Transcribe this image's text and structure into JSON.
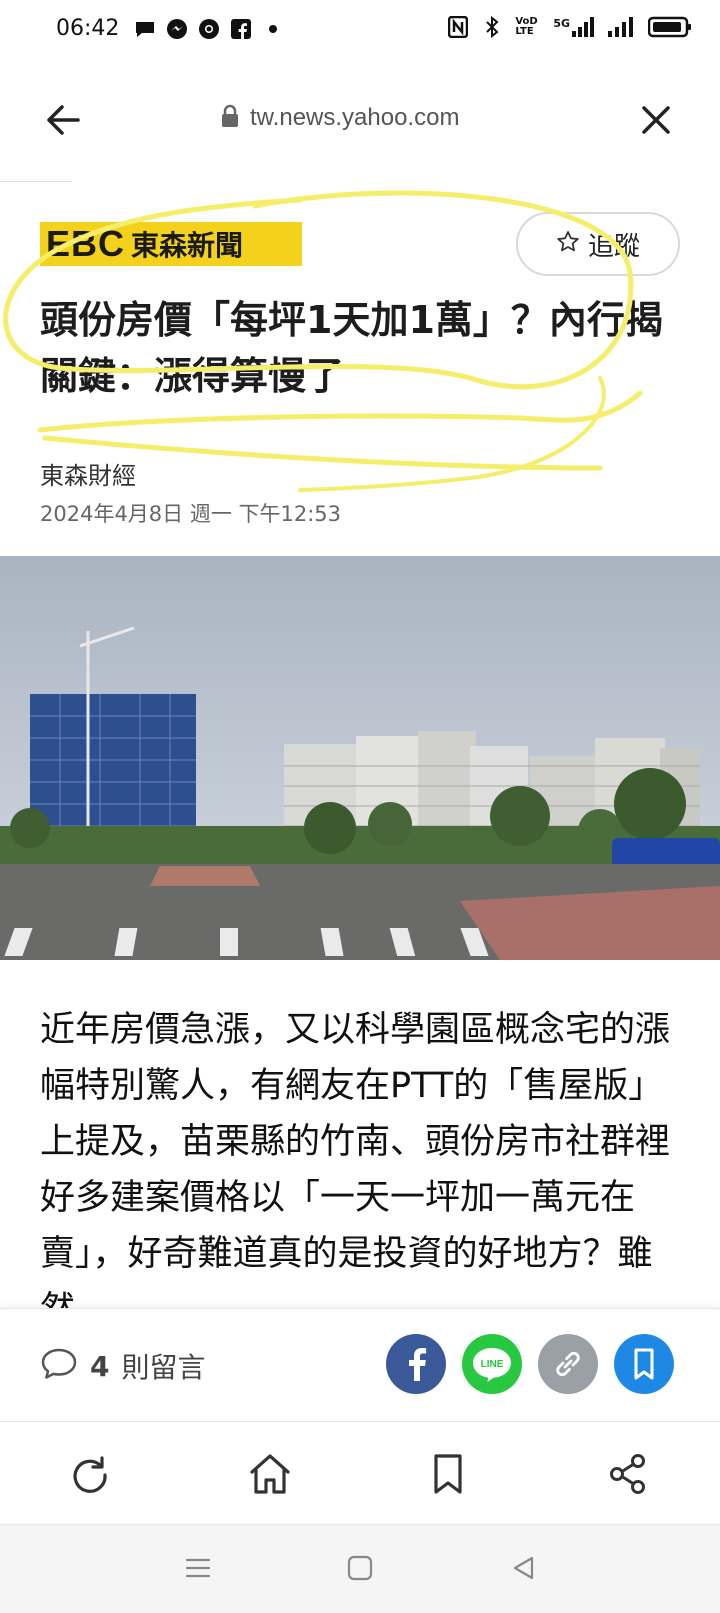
{
  "status_bar": {
    "time": "06:42",
    "left_icons": [
      "chat-bubble-icon",
      "messenger-icon",
      "chrome-icon",
      "facebook-icon",
      "dot-icon"
    ],
    "right_icons": [
      "nfc-icon",
      "bluetooth-icon",
      "volte-icon",
      "5g-signal-icon",
      "signal-icon",
      "battery-icon"
    ],
    "volte": "VoD LTE",
    "network": "5G"
  },
  "browser": {
    "url": "tw.news.yahoo.com"
  },
  "article": {
    "publisher_logo_text": "EBC",
    "publisher_name": "東森新聞",
    "follow_label": "追蹤",
    "headline": "頭份房價「每坪1天加1萬」？內行揭關鍵：漲得算慢了",
    "source": "東森財經",
    "date": "2024年4月8日 週一 下午12:53",
    "body": "近年房價急漲，又以科學園區概念宅的漲幅特別驚人，有網友在PTT的「售屋版」上提及，苗栗縣的竹南、頭份房市社群裡好多建案價格以「一天一坪加一萬元在賣」，好奇難道真的是投資的好地方？雖然"
  },
  "comment_bar": {
    "count": "4",
    "label": "則留言"
  },
  "share_buttons": [
    {
      "name": "facebook",
      "color": "#3b5998"
    },
    {
      "name": "line",
      "color": "#28c840",
      "label": "LINE"
    },
    {
      "name": "link",
      "color": "#9aa0a6"
    },
    {
      "name": "bookmark",
      "color": "#1e88e5"
    }
  ],
  "toolbar": [
    "refresh-icon",
    "home-icon",
    "bookmark-icon",
    "share-icon"
  ],
  "navbar": [
    "menu-icon",
    "home-square-icon",
    "back-triangle-icon"
  ],
  "colors": {
    "ebc_yellow": "#f4d21b",
    "annotation_yellow": "#f5ee6a",
    "facebook": "#3b5998",
    "line": "#28c840",
    "link_gray": "#9aa0a6",
    "bookmark_blue": "#1e88e5"
  }
}
